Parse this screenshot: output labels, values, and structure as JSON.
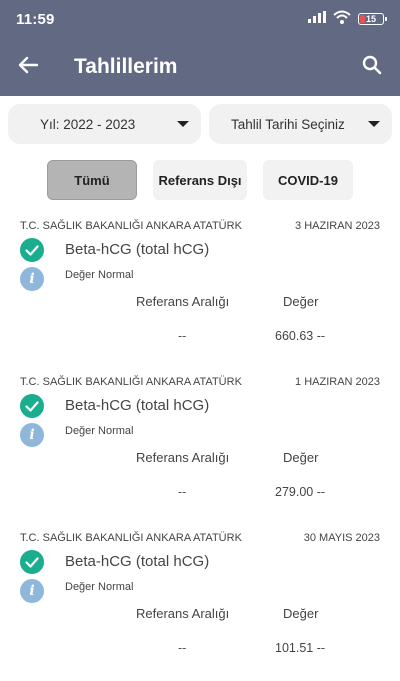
{
  "status_bar": {
    "time": "11:59",
    "battery": "15",
    "icons": [
      "signal-icon",
      "wifi-icon",
      "battery-icon"
    ]
  },
  "app_bar": {
    "title": "Tahlillerim",
    "back_icon": "arrow-left-icon",
    "search_icon": "search-icon",
    "color": "#616a82"
  },
  "filters": {
    "year": "Yıl: 2022 - 2023",
    "date": "Tahlil Tarihi Seçiniz"
  },
  "tabs": [
    {
      "label": "Tümü",
      "active": true
    },
    {
      "label": "Referans Dışı",
      "active": false
    },
    {
      "label": "COVID-19",
      "active": false
    }
  ],
  "results": [
    {
      "hospital": "T.C. SAĞLIK BAKANLIĞI ANKARA ATATÜRK",
      "date": "3 HAZIRAN 2023",
      "test": "Beta-hCG (total hCG)",
      "status": "Değer Normal",
      "ref_label": "Referans Aralığı",
      "val_label": "Değer",
      "ref_value": "--",
      "value": "660.63 --"
    },
    {
      "hospital": "T.C. SAĞLIK BAKANLIĞI ANKARA ATATÜRK",
      "date": "1 HAZIRAN 2023",
      "test": "Beta-hCG (total hCG)",
      "status": "Değer Normal",
      "ref_label": "Referans Aralığı",
      "val_label": "Değer",
      "ref_value": "--",
      "value": "279.00 --"
    },
    {
      "hospital": "T.C. SAĞLIK BAKANLIĞI ANKARA ATATÜRK",
      "date": "30 MAYIS 2023",
      "test": "Beta-hCG (total hCG)",
      "status": "Değer Normal",
      "ref_label": "Referans Aralığı",
      "val_label": "Değer",
      "ref_value": "--",
      "value": "101.51 --"
    }
  ],
  "colors": {
    "accent_green": "#1aae8f",
    "info_blue": "#8fb6db"
  }
}
